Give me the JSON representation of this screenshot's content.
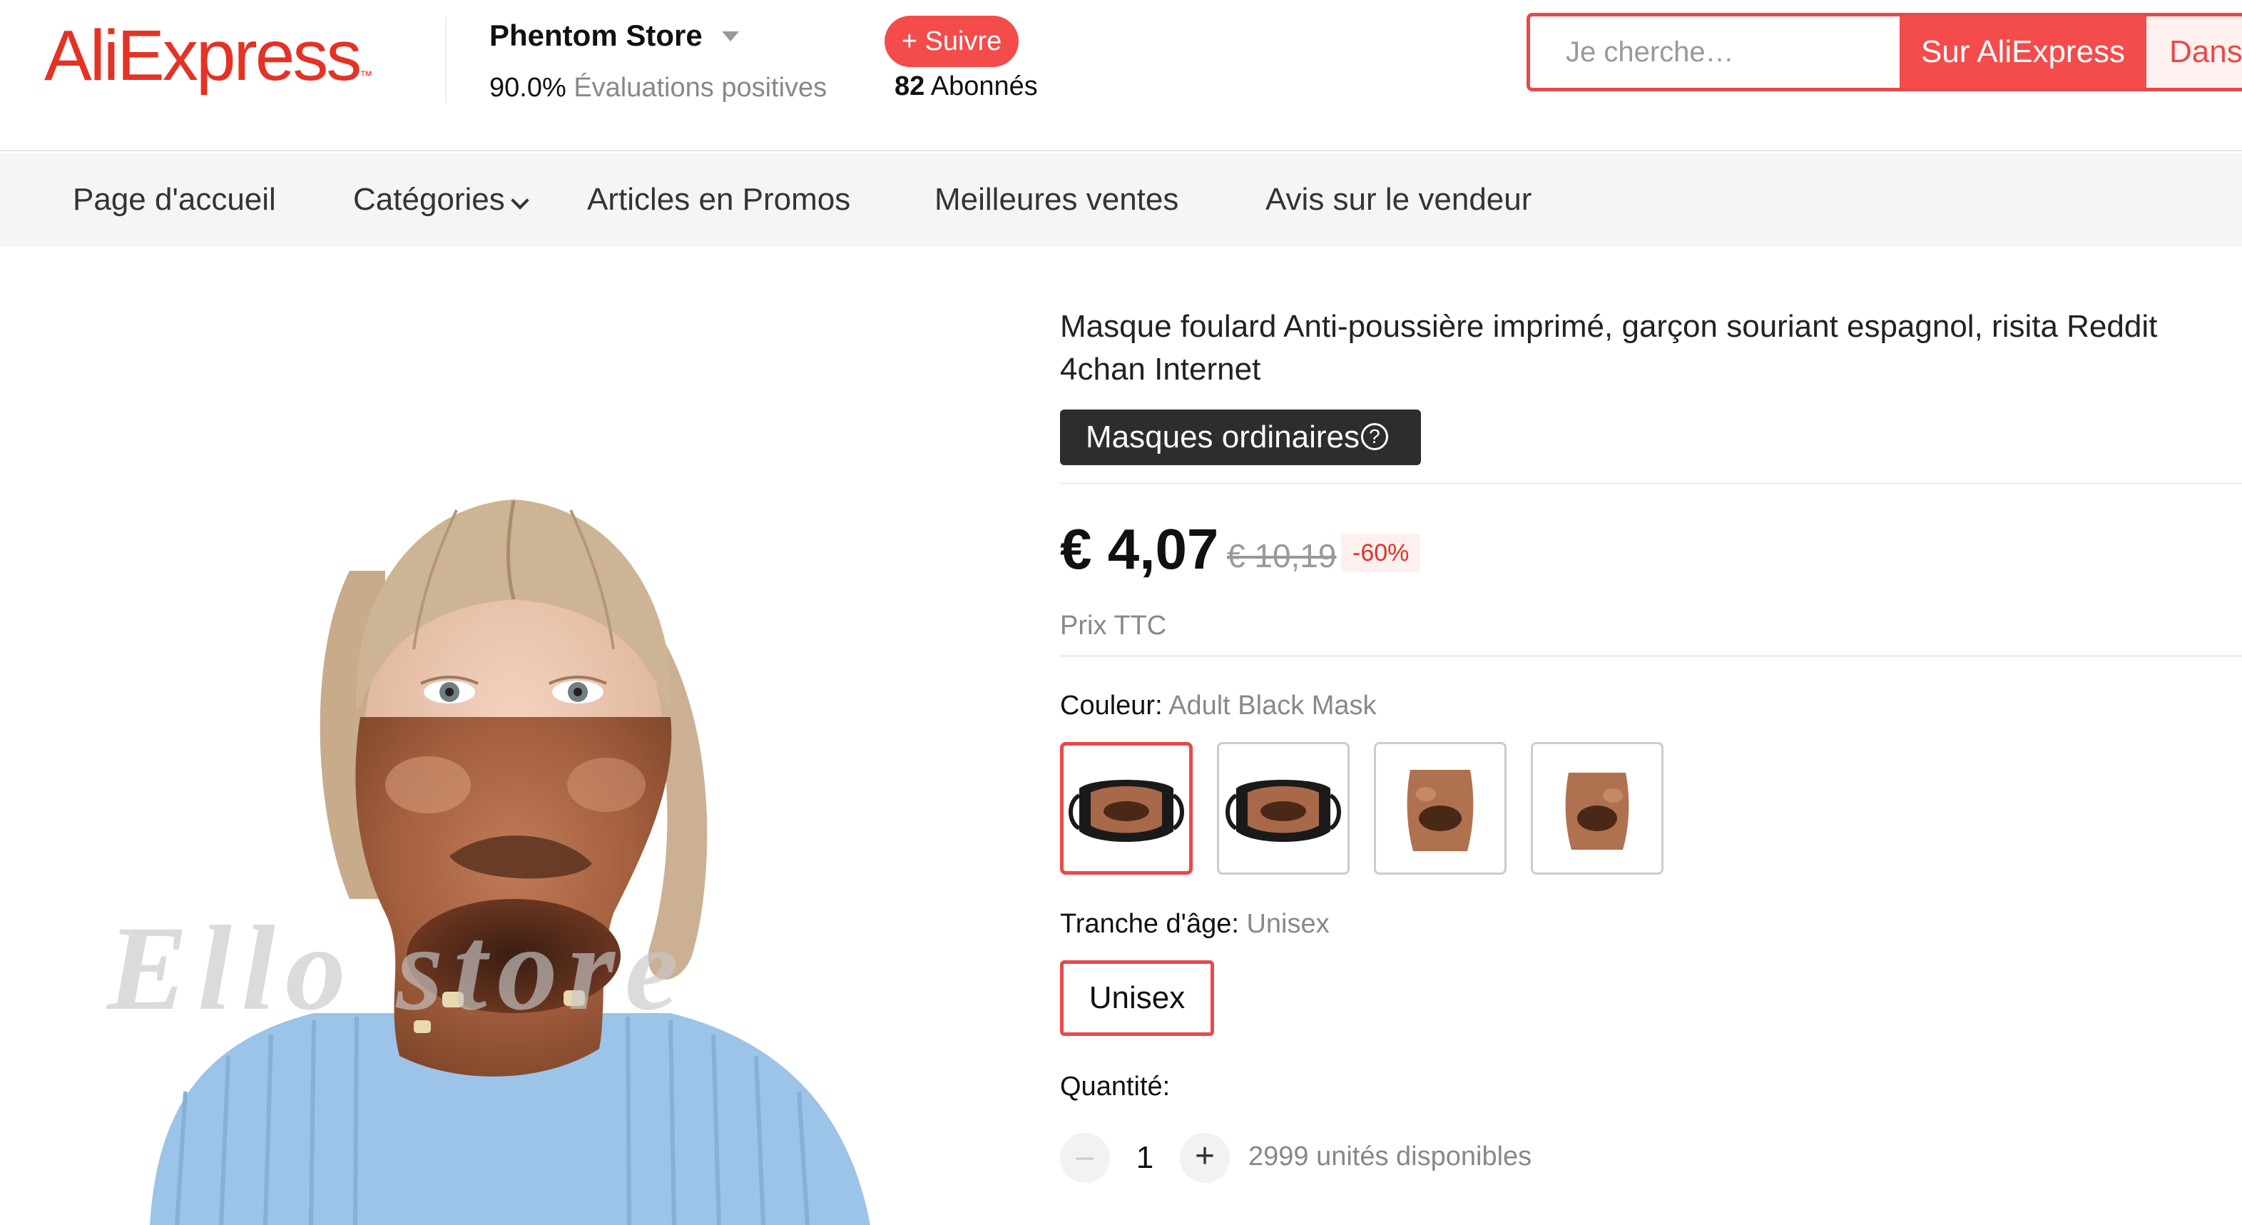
{
  "header": {
    "logo_text": "AliExpress",
    "logo_tm": "™",
    "store_name": "Phentom Store",
    "rating_value": "90.0%",
    "rating_label": "Évaluations positives",
    "follow_label": "+ Suivre",
    "followers_count": "82",
    "followers_label": "Abonnés",
    "search_placeholder": "Je cherche…",
    "search_aliexpress_label": "Sur AliExpress",
    "search_store_label": "Dans",
    "accent_color": "#f44b4b"
  },
  "nav": {
    "items": [
      "Page d'accueil",
      "Catégories",
      "Articles en Promos",
      "Meilleures ventes",
      "Avis sur le vendeur"
    ]
  },
  "gallery": {
    "watermark": "Ello store"
  },
  "product": {
    "title": "Masque foulard Anti-poussière imprimé, garçon souriant espagnol, risita Reddit 4chan Internet",
    "badge": "Masques ordinaires",
    "help_icon": "?",
    "price": "€ 4,07",
    "old_price": "€ 10,19",
    "discount": "-60%",
    "tax_note": "Prix TTC",
    "color_label": "Couleur:",
    "color_value": "Adult Black Mask",
    "swatches": [
      {
        "name": "Adult Black Mask",
        "selected": true
      },
      {
        "name": "Child Black Mask",
        "selected": false
      },
      {
        "name": "Adult Scarf",
        "selected": false
      },
      {
        "name": "Child Scarf",
        "selected": false
      }
    ],
    "age_label": "Tranche d'âge:",
    "age_value": "Unisex",
    "age_option": "Unisex",
    "quantity_label": "Quantité:",
    "quantity_minus": "–",
    "quantity_value": "1",
    "quantity_plus": "+",
    "available": "2999 unités disponibles"
  }
}
